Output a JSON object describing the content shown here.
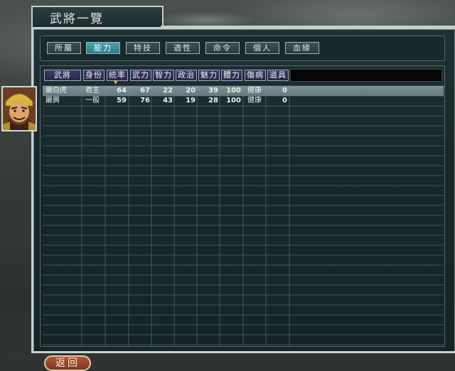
{
  "window": {
    "title": "武將一覽"
  },
  "tabs": [
    {
      "label": "所屬",
      "active": false
    },
    {
      "label": "能力",
      "active": true
    },
    {
      "label": "特技",
      "active": false
    },
    {
      "label": "適性",
      "active": false
    },
    {
      "label": "命令",
      "active": false
    },
    {
      "label": "個人",
      "active": false
    },
    {
      "label": "血緣",
      "active": false
    }
  ],
  "table": {
    "columns": [
      "武將",
      "身份",
      "統率",
      "武力",
      "智力",
      "政治",
      "魅力",
      "體力",
      "傷病",
      "道具"
    ],
    "sort_column": "統率",
    "rows": [
      {
        "name": "嚴白虎",
        "rank": "君主",
        "lead": "64",
        "war": "67",
        "int": "22",
        "pol": "20",
        "cha": "39",
        "hp": "100",
        "status": "健康",
        "items": "0",
        "selected": true
      },
      {
        "name": "嚴輿",
        "rank": "一般",
        "lead": "59",
        "war": "76",
        "int": "43",
        "pol": "19",
        "cha": "28",
        "hp": "100",
        "status": "健康",
        "items": "0",
        "selected": false
      }
    ]
  },
  "buttons": {
    "back_label": "返回"
  },
  "colors": {
    "active_tab": "#3b95a0",
    "header_bg": "#33305a",
    "selected_row": "#8499a0",
    "back_button": "#9c4a30"
  }
}
